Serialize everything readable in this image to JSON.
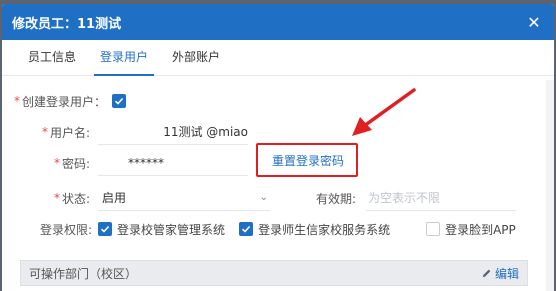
{
  "dialog": {
    "title": "修改员工：11测试",
    "close_glyph": "✕"
  },
  "tabs": [
    {
      "label": "员工信息"
    },
    {
      "label": "登录用户"
    },
    {
      "label": "外部账户"
    }
  ],
  "form": {
    "create_login": {
      "label": "创建登录用户：",
      "checked": true
    },
    "username": {
      "label": "用户名:",
      "value": "11测试 @miao"
    },
    "password": {
      "label": "密码:",
      "value": "******",
      "reset_label": "重置登录密码"
    },
    "status": {
      "label": "状态:",
      "value": "启用",
      "caret": "⌄"
    },
    "validity": {
      "label": "有效期:",
      "placeholder": "为空表示不限"
    },
    "permissions": {
      "label": "登录权限:",
      "items": [
        {
          "label": "登录校管家管理系统",
          "checked": true
        },
        {
          "label": "登录师生信家校服务系统",
          "checked": true
        },
        {
          "label": "登录脸到APP",
          "checked": false
        }
      ]
    },
    "department": {
      "label": "可操作部门（校区）",
      "edit_label": "编辑"
    }
  },
  "required_mark": "*",
  "colors": {
    "accent": "#1f6fc5",
    "annotation": "#e02020",
    "required": "#e84a4a"
  }
}
